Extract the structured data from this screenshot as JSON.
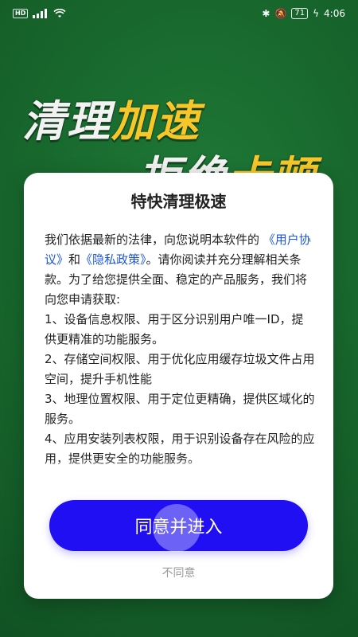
{
  "status_bar": {
    "left_icons": [
      "hd-icon",
      "signal-icon",
      "wifi-icon"
    ],
    "right_icons": [
      "bluetooth-icon",
      "mute-icon",
      "battery-icon",
      "charging-icon"
    ],
    "battery": "71",
    "time": "4:06",
    "hd_label": "HD"
  },
  "hero": {
    "line1_white": "清理",
    "line1_yellow": "加速",
    "line2_white": "拒绝",
    "line2_yellow": "卡顿",
    "colors": {
      "white": "#f2f2f2",
      "yellow": "#f7c72a",
      "bg": "#17652c"
    }
  },
  "dialog": {
    "title": "特快清理极速",
    "intro_part1": "我们依据最新的法律，向您说明本软件的",
    "link_user": "《用户协议》",
    "and": "和",
    "link_privacy": "《隐私政策》",
    "intro_part2": "。请你阅读并充分理解相关条款。为了给您提供全面、稳定的产品服务，我们将向您申请获取:",
    "items": [
      "1、设备信息权限、用于区分识别用户唯一ID，提供更精准的功能服务。",
      "2、存储空间权限、用于优化应用缓存垃圾文件占用空间，提升手机性能",
      "3、地理位置权限、用于定位更精确，提供区域化的服务。",
      "4、应用安装列表权限，用于识别设备存在风险的应用，提供更安全的功能服务。"
    ],
    "agree_label": "同意并进入",
    "disagree_label": "不同意",
    "colors": {
      "button": "#1f0ff2",
      "link": "#1e57d8"
    }
  }
}
